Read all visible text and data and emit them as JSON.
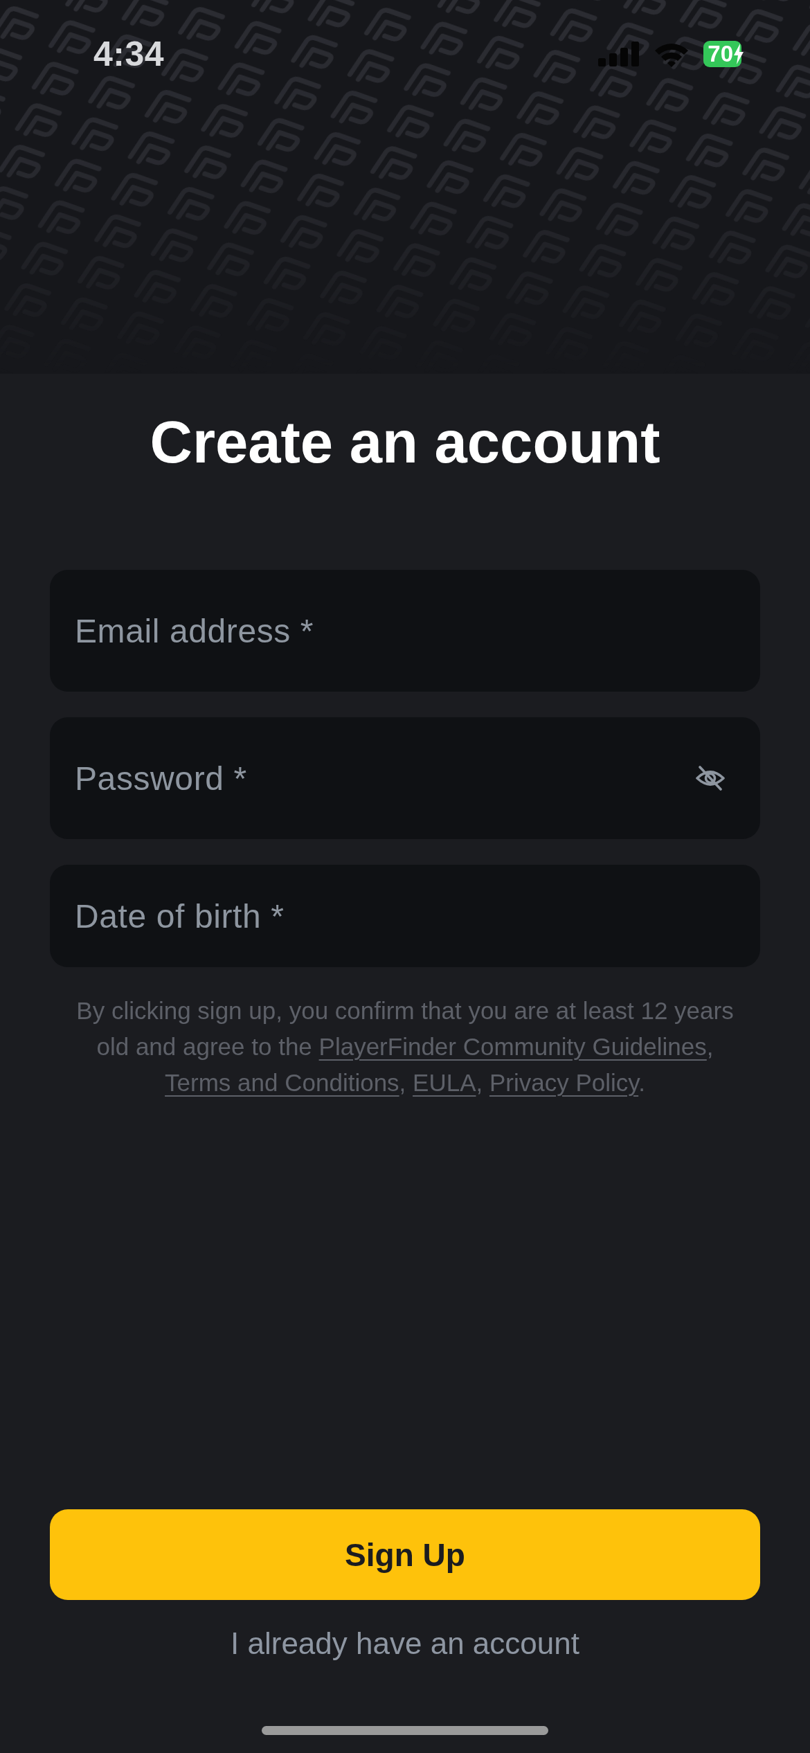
{
  "status_bar": {
    "time": "4:34",
    "battery": "70",
    "charging": true
  },
  "title": "Create an account",
  "fields": [
    {
      "kind": "email",
      "placeholder": "Email address *"
    },
    {
      "kind": "password",
      "placeholder": "Password *"
    },
    {
      "kind": "date",
      "placeholder": "Date of birth *"
    }
  ],
  "legal_text": [
    {
      "kind": "plain",
      "text": "By clicking sign up, you confirm that you are at least 12 years old and agree to the "
    },
    {
      "kind": "link",
      "text": "PlayerFinder Community Guidelines"
    },
    {
      "kind": "plain",
      "text": ", "
    },
    {
      "kind": "link",
      "text": "Terms and Conditions"
    },
    {
      "kind": "plain",
      "text": ", "
    },
    {
      "kind": "link",
      "text": "EULA"
    },
    {
      "kind": "plain",
      "text": ", "
    },
    {
      "kind": "link",
      "text": "Privacy Policy"
    },
    {
      "kind": "plain",
      "text": "."
    }
  ],
  "sign_up_button": "Sign Up",
  "login_link": "I already have an account"
}
